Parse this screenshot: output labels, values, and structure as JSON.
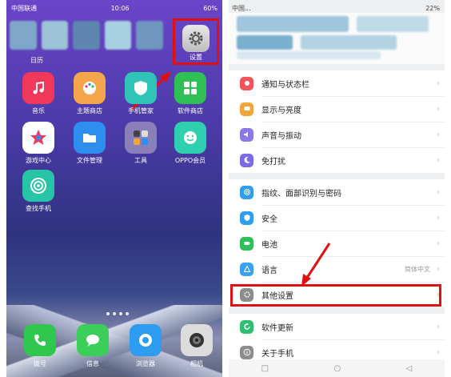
{
  "left_phone": {
    "status": {
      "carrier": "中国联通",
      "time": "10:06",
      "battery": "60%"
    },
    "blurred_top_label": "日历",
    "settings_app": {
      "label": "设置",
      "icon": "gear-icon"
    },
    "apps": [
      {
        "label": "音乐",
        "icon": "music-icon",
        "color": "#f2385a"
      },
      {
        "label": "主题商店",
        "icon": "palette-icon",
        "color": "#f6a64a"
      },
      {
        "label": "手机管家",
        "icon": "shield-icon",
        "color": "#2ec4b6"
      },
      {
        "label": "软件商店",
        "icon": "grid-icon",
        "color": "#2fbf54"
      },
      {
        "label": "游戏中心",
        "icon": "star-icon",
        "color": "#ffffff"
      },
      {
        "label": "文件管理",
        "icon": "folder-icon",
        "color": "#2e8ef0"
      },
      {
        "label": "工具",
        "icon": "tools-folder-icon",
        "color": "#8a7fb8"
      },
      {
        "label": "OPPO会员",
        "icon": "smile-icon",
        "color": "#2ed0b0"
      },
      {
        "label": "查找手机",
        "icon": "radar-icon",
        "color": "#27c4a8"
      }
    ],
    "dock": [
      {
        "label": "拨号",
        "icon": "phone-icon",
        "color": "#2fc74d"
      },
      {
        "label": "信息",
        "icon": "message-icon",
        "color": "#3bcf5a"
      },
      {
        "label": "浏览器",
        "icon": "browser-icon",
        "color": "#2e9cf0"
      },
      {
        "label": "相机",
        "icon": "camera-icon",
        "color": "#dcdcdc"
      }
    ]
  },
  "right_phone": {
    "status": {
      "carrier": "中国...",
      "battery": "22%"
    },
    "group1": [
      {
        "label": "通知与状态栏",
        "icon": "notification-icon",
        "color": "#f2545b"
      },
      {
        "label": "显示与亮度",
        "icon": "display-icon",
        "color": "#f2a53a"
      },
      {
        "label": "声音与振动",
        "icon": "sound-icon",
        "color": "#8a78e8"
      },
      {
        "label": "免打扰",
        "icon": "moon-icon",
        "color": "#7a6be6"
      }
    ],
    "group2": [
      {
        "label": "指纹、面部识别与密码",
        "icon": "fingerprint-icon",
        "color": "#2f9ef2",
        "value": ""
      },
      {
        "label": "安全",
        "icon": "shield-check-icon",
        "color": "#2f9ef2",
        "value": ""
      },
      {
        "label": "电池",
        "icon": "battery-icon",
        "color": "#2fbf5a",
        "value": ""
      },
      {
        "label": "语言",
        "icon": "language-icon",
        "color": "#3ba0f2",
        "value": "简体中文"
      },
      {
        "label": "其他设置",
        "icon": "gear-icon",
        "color": "#8d8d8d",
        "value": ""
      }
    ],
    "group3": [
      {
        "label": "软件更新",
        "icon": "update-icon",
        "color": "#2fbf72"
      },
      {
        "label": "关于手机",
        "icon": "info-icon",
        "color": "#8d8d8d"
      }
    ],
    "navbar": {
      "back": "◁",
      "home": "○",
      "recent": "□"
    }
  }
}
